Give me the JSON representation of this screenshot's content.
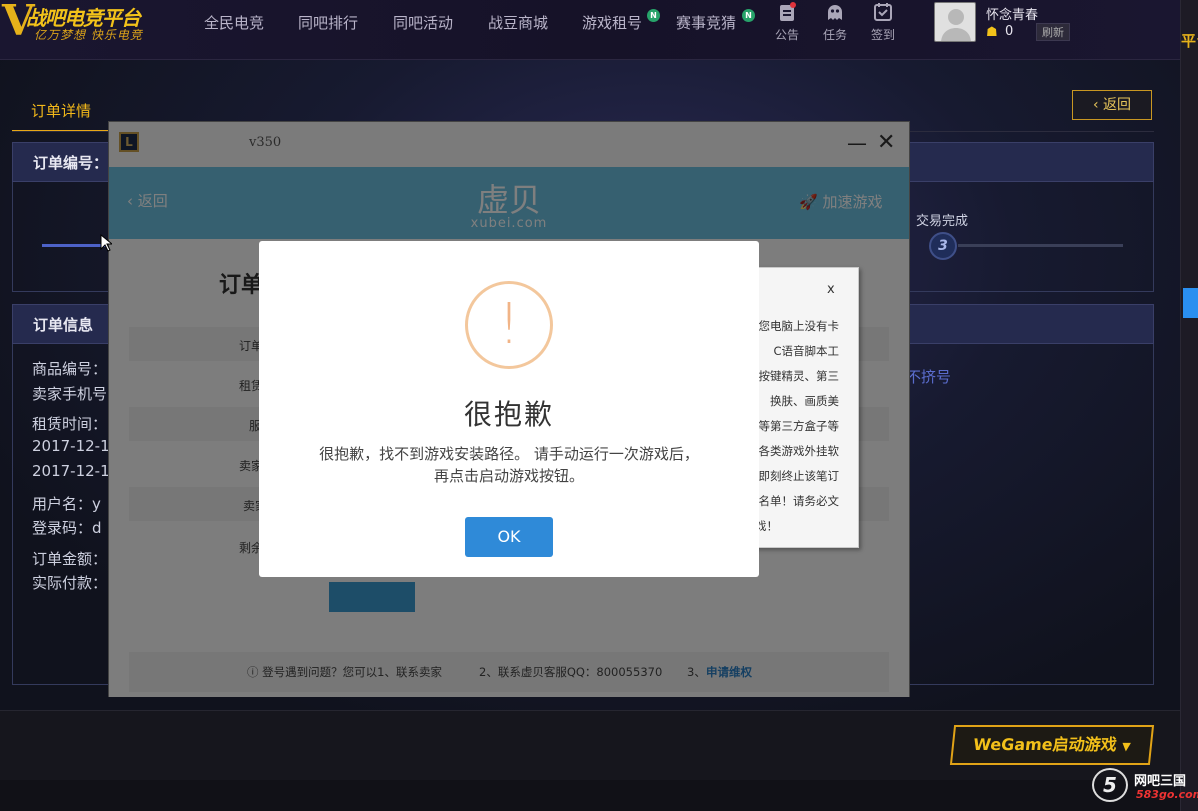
{
  "nav": {
    "logo_title": "战吧电竞平台",
    "logo_sub": "亿万梦想  快乐电竞",
    "items": [
      "全民电竞",
      "同吧排行",
      "同吧活动",
      "战豆商城",
      "游戏租号",
      "赛事竞猜"
    ],
    "new_badge": "N",
    "tools": [
      {
        "icon": "announcement-icon",
        "label": "公告"
      },
      {
        "icon": "task-icon",
        "label": "任务"
      },
      {
        "icon": "checkin-icon",
        "label": "签到"
      }
    ],
    "username": "怀念青春",
    "coins": "0",
    "refresh_label": "刷新",
    "edge_text": "平台"
  },
  "page": {
    "tab_label": "订单详情",
    "back_label": "返回",
    "order_no_label": "订单编号：",
    "step_done_label": "交易完成",
    "step_num": "3",
    "info_header": "订单信息",
    "info_lines": [
      "商品编号：",
      "卖家手机号",
      "租赁时间：",
      "2017-12-1",
      "2017-12-1",
      "用户名：y",
      "登录码：d",
      "订单金额：",
      "实际付款："
    ],
    "side_link": "不挤号",
    "wegame_label": "WeGame启动游戏"
  },
  "client": {
    "version": "v350",
    "back_label": "返回",
    "brand_cn": "虚贝",
    "brand_en": "xubei.com",
    "speedup_label": "加速游戏",
    "order_title": "订单",
    "row_labels": [
      "订单",
      "租赁",
      "服",
      "卖家",
      "卖家",
      "剩余"
    ],
    "footer_q": "登号遇到问题？您可以1、联系卖家",
    "footer_qq": "2、联系虚贝客服QQ：800055370",
    "footer_n": "3、",
    "footer_link": "申请维权",
    "popup_close": "x",
    "popup_mark": "：",
    "popup_lines": [
      "您电脑上没有卡",
      "C语音脚本工",
      "按键精灵、第三",
      "换肤、画质美",
      "等第三方盒子等",
      "各类游戏外挂软",
      "即刻终止该笔订",
      "名单！请务必文",
      "戏！"
    ]
  },
  "modal": {
    "icon_char": "!",
    "title": "很抱歉",
    "message_1": "很抱歉，找不到游戏安装路径。 请手动运行一次游戏后，",
    "message_2": "再点击启动游戏按钮。",
    "ok_label": "OK"
  },
  "watermark": {
    "site_cn": "网吧三国",
    "site_url": "583go.com"
  }
}
